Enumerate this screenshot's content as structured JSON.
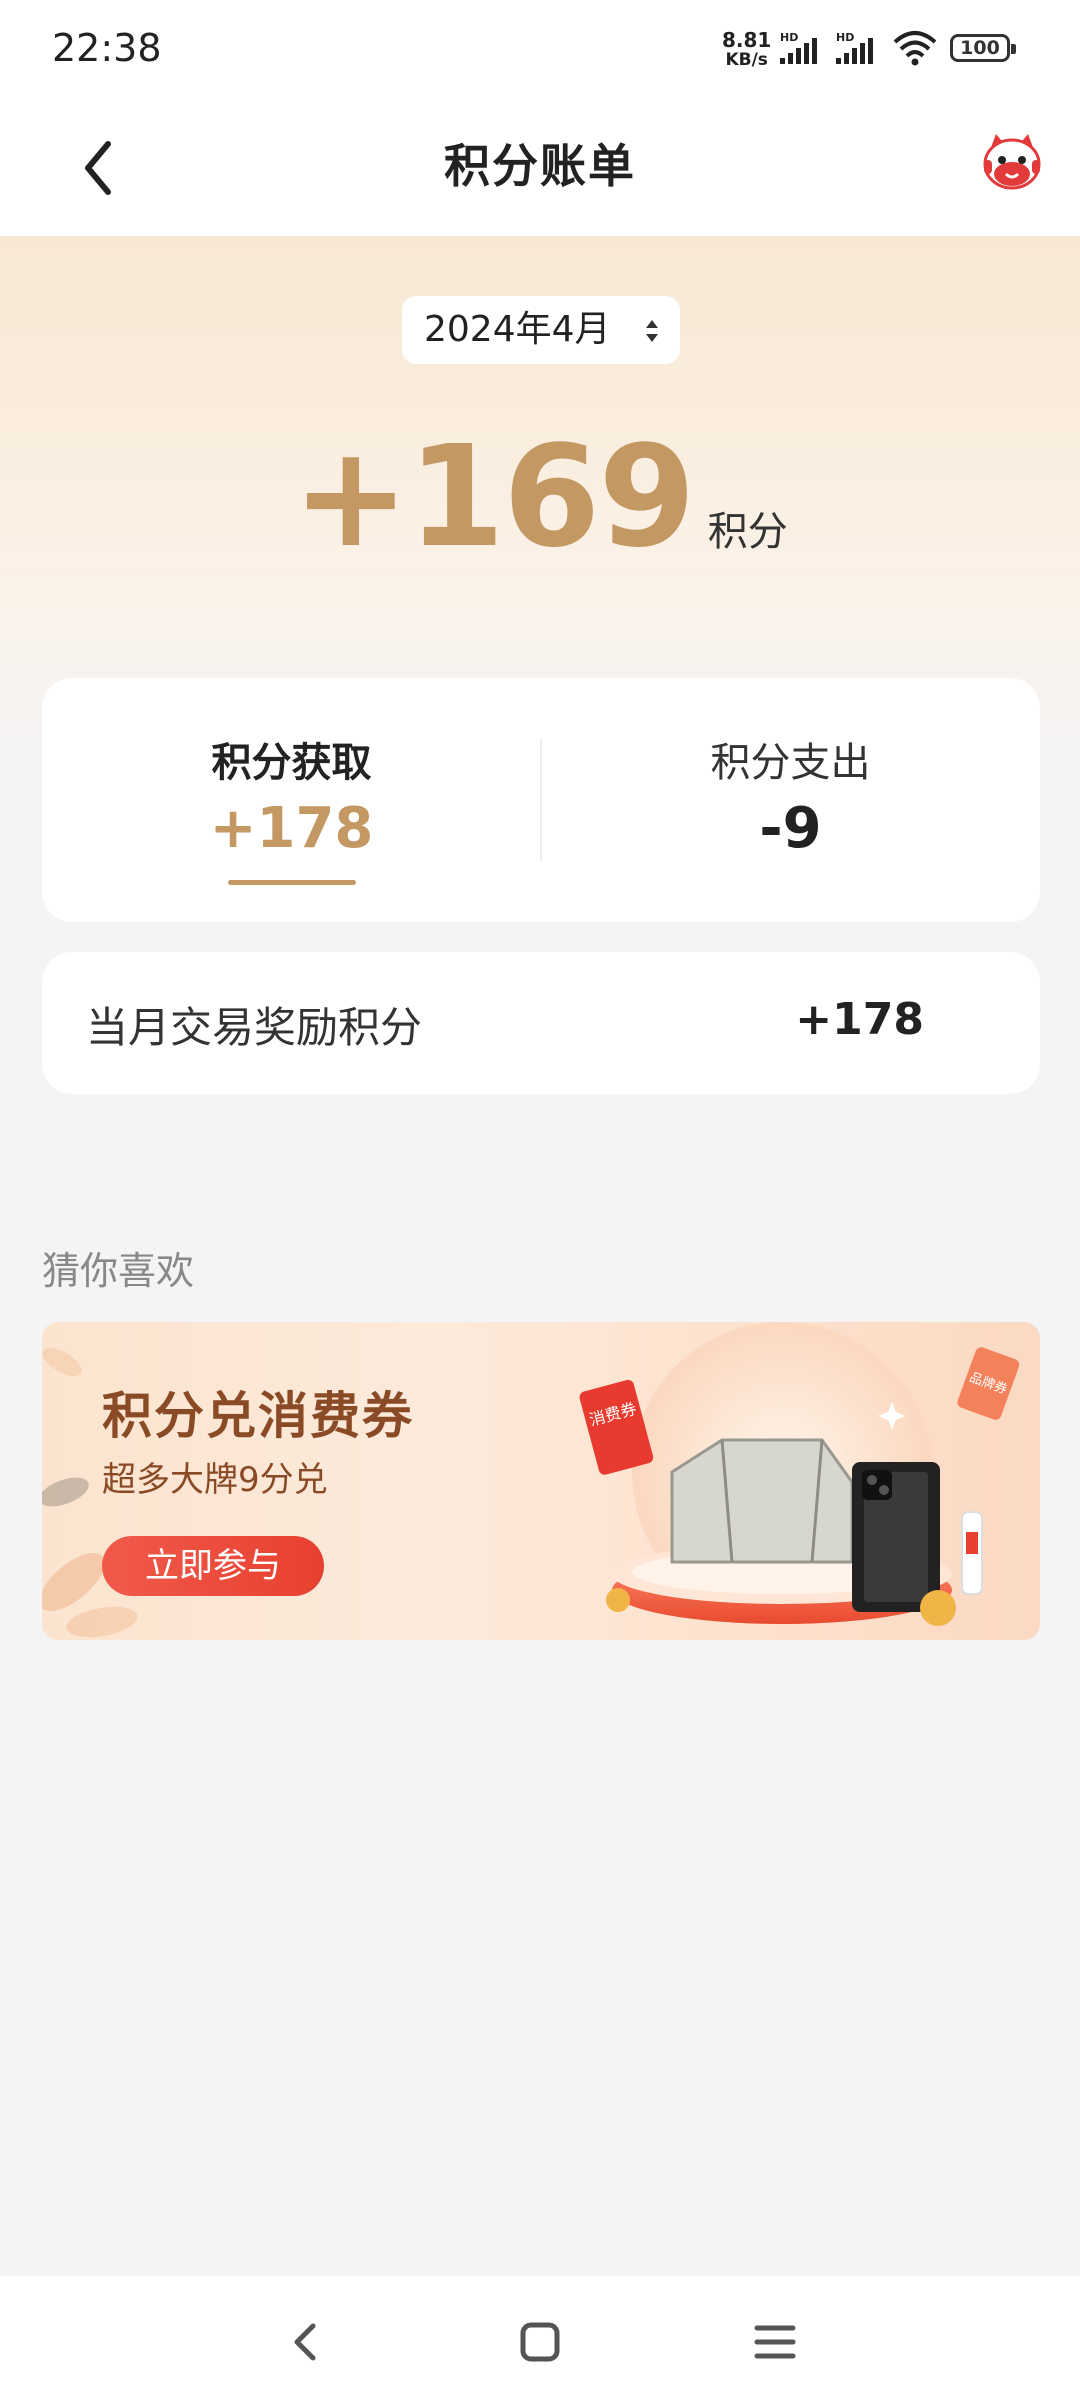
{
  "status_bar": {
    "time": "22:38",
    "net_speed_value": "8.81",
    "net_speed_unit": "KB/s",
    "signal_1_label": "HD",
    "signal_2_label": "HD",
    "battery": "100"
  },
  "header": {
    "title": "积分账单"
  },
  "summary": {
    "month": "2024年4月",
    "total": "+169",
    "unit": "积分"
  },
  "tabs": [
    {
      "label": "积分获取",
      "value": "+178"
    },
    {
      "label": "积分支出",
      "value": "-9"
    }
  ],
  "detail": {
    "label": "当月交易奖励积分",
    "value": "+178"
  },
  "recommend": {
    "title": "猜你喜欢",
    "banner": {
      "title": "积分兑消费券",
      "subtitle": "超多大牌9分兑",
      "button": "立即参与",
      "tag1": "消费券",
      "tag2": "品牌券"
    }
  },
  "colors": {
    "accent": "#c49863",
    "banner_button": "#e8402f"
  },
  "icons": {
    "back": "chevron-left-icon",
    "mascot": "mascot-icon",
    "sort": "sort-arrows-icon",
    "nav_back": "nav-back-icon",
    "nav_home": "nav-home-icon",
    "nav_menu": "nav-menu-icon"
  }
}
